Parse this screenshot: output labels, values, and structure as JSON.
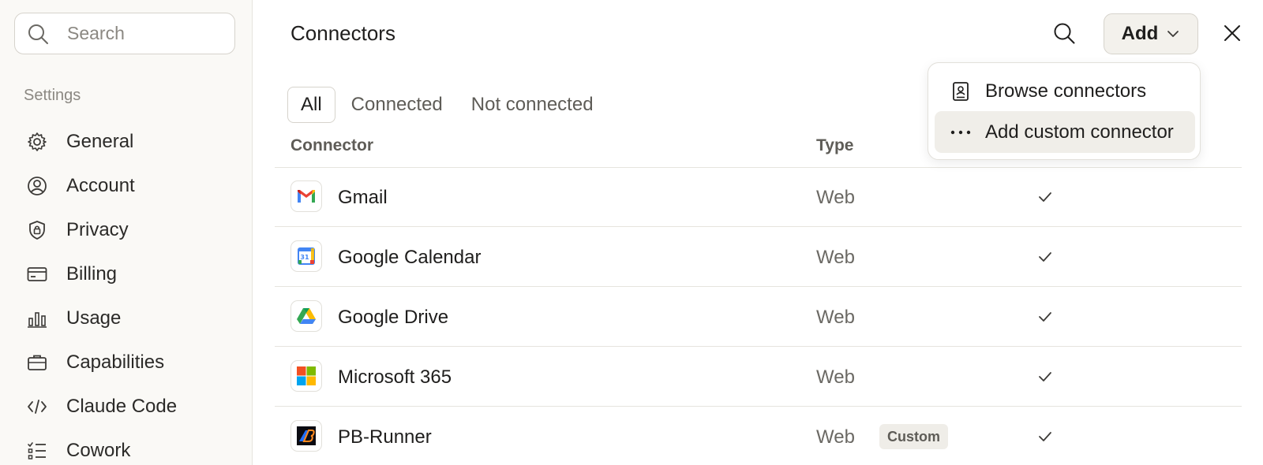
{
  "sidebar": {
    "search": {
      "placeholder": "Search",
      "icon": "search-icon"
    },
    "section_label": "Settings",
    "items": [
      {
        "label": "General",
        "icon": "gear-icon"
      },
      {
        "label": "Account",
        "icon": "user-circle-icon"
      },
      {
        "label": "Privacy",
        "icon": "shield-lock-icon"
      },
      {
        "label": "Billing",
        "icon": "credit-card-icon"
      },
      {
        "label": "Usage",
        "icon": "bar-chart-icon"
      },
      {
        "label": "Capabilities",
        "icon": "briefcase-icon"
      },
      {
        "label": "Claude Code",
        "icon": "code-icon"
      },
      {
        "label": "Cowork",
        "icon": "checklist-icon"
      }
    ]
  },
  "header": {
    "title": "Connectors",
    "add_label": "Add",
    "search_icon": "search-icon",
    "close_icon": "close-icon"
  },
  "tabs": [
    {
      "label": "All",
      "active": true
    },
    {
      "label": "Connected",
      "active": false
    },
    {
      "label": "Not connected",
      "active": false
    }
  ],
  "table": {
    "columns": [
      "Connector",
      "Type"
    ],
    "rows": [
      {
        "name": "Gmail",
        "type": "Web",
        "badge": "",
        "connected": true,
        "logo": "gmail-logo"
      },
      {
        "name": "Google Calendar",
        "type": "Web",
        "badge": "",
        "connected": true,
        "logo": "google-calendar-logo"
      },
      {
        "name": "Google Drive",
        "type": "Web",
        "badge": "",
        "connected": true,
        "logo": "google-drive-logo"
      },
      {
        "name": "Microsoft 365",
        "type": "Web",
        "badge": "",
        "connected": true,
        "logo": "microsoft-365-logo"
      },
      {
        "name": "PB-Runner",
        "type": "Web",
        "badge": "Custom",
        "connected": true,
        "logo": "pb-runner-logo"
      }
    ]
  },
  "add_menu": {
    "items": [
      {
        "label": "Browse connectors",
        "icon": "book-user-icon"
      },
      {
        "label": "Add custom connector",
        "icon": "more-horizontal-icon"
      }
    ]
  },
  "colors": {
    "sidebar_bg": "#faf9f6",
    "border": "#e6e4de",
    "muted_text": "#8b8882",
    "hover_bg": "#f0eee9"
  }
}
